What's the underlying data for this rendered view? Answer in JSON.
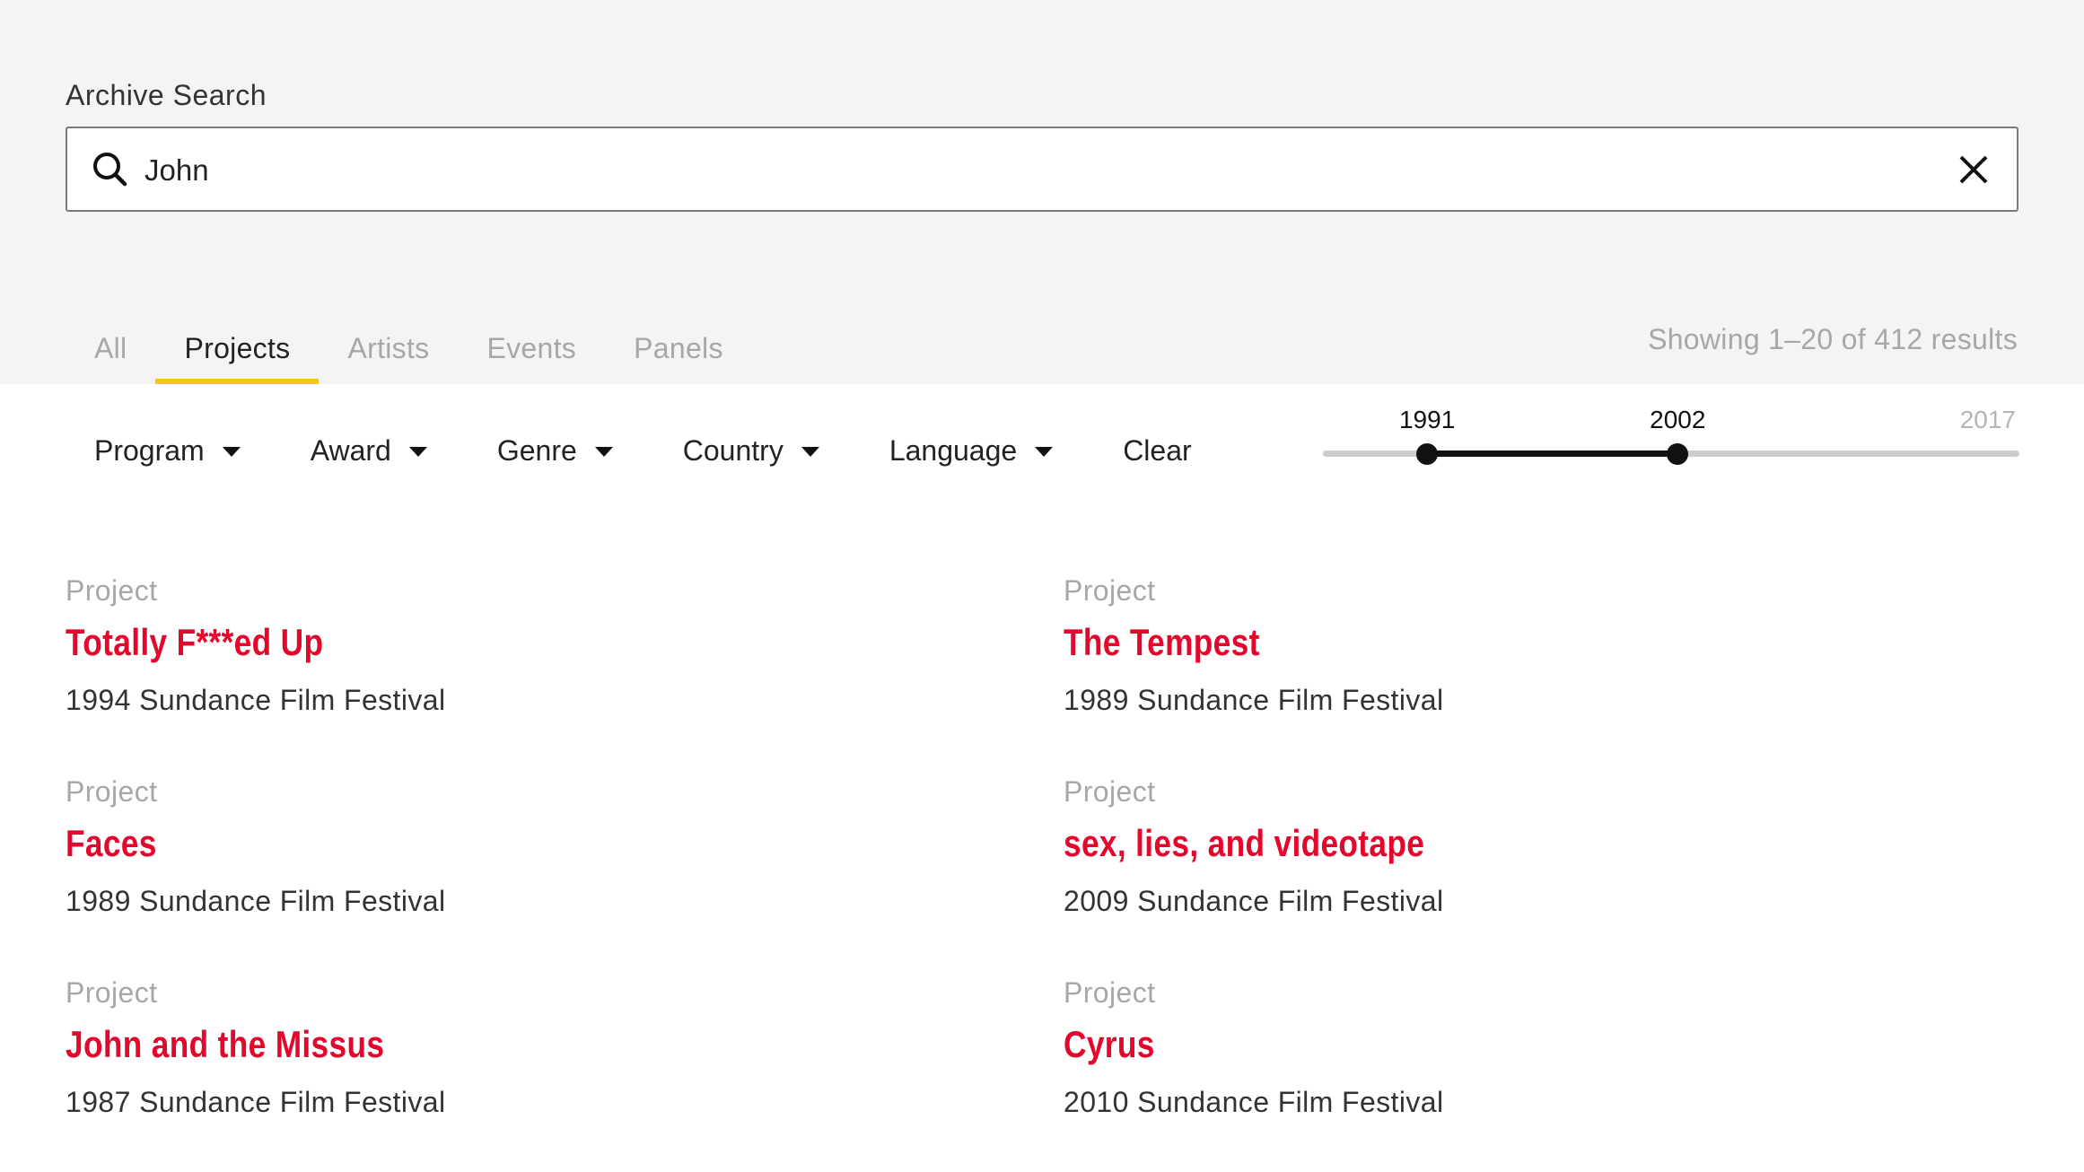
{
  "search": {
    "label": "Archive Search",
    "value": "John"
  },
  "tabs": [
    {
      "label": "All",
      "active": false
    },
    {
      "label": "Projects",
      "active": true
    },
    {
      "label": "Artists",
      "active": false
    },
    {
      "label": "Events",
      "active": false
    },
    {
      "label": "Panels",
      "active": false
    }
  ],
  "result_count": "Showing 1–20 of 412 results",
  "filters": {
    "program": "Program",
    "award": "Award",
    "genre": "Genre",
    "country": "Country",
    "language": "Language",
    "clear": "Clear"
  },
  "year_range": {
    "min": 1988,
    "max": 2017,
    "from": 1991,
    "to": 2002,
    "from_label": "1991",
    "to_label": "2002",
    "max_label": "2017"
  },
  "results": [
    {
      "kind": "Project",
      "title": "Totally F***ed Up",
      "meta": "1994 Sundance Film Festival"
    },
    {
      "kind": "Project",
      "title": "The Tempest",
      "meta": "1989 Sundance Film Festival"
    },
    {
      "kind": "Project",
      "title": "Faces",
      "meta": "1989 Sundance Film Festival"
    },
    {
      "kind": "Project",
      "title": "sex, lies, and videotape",
      "meta": "2009 Sundance Film Festival"
    },
    {
      "kind": "Project",
      "title": "John and the Missus",
      "meta": "1987 Sundance Film Festival"
    },
    {
      "kind": "Project",
      "title": "Cyrus",
      "meta": "2010 Sundance Film Festival"
    }
  ],
  "colors": {
    "accent_tab_underline": "#f5c518",
    "title_red": "#e2072b",
    "header_bg": "#f4f4f4"
  },
  "icons": {
    "search": "search-icon",
    "clear": "close-icon",
    "dropdown": "caret-down-icon"
  }
}
